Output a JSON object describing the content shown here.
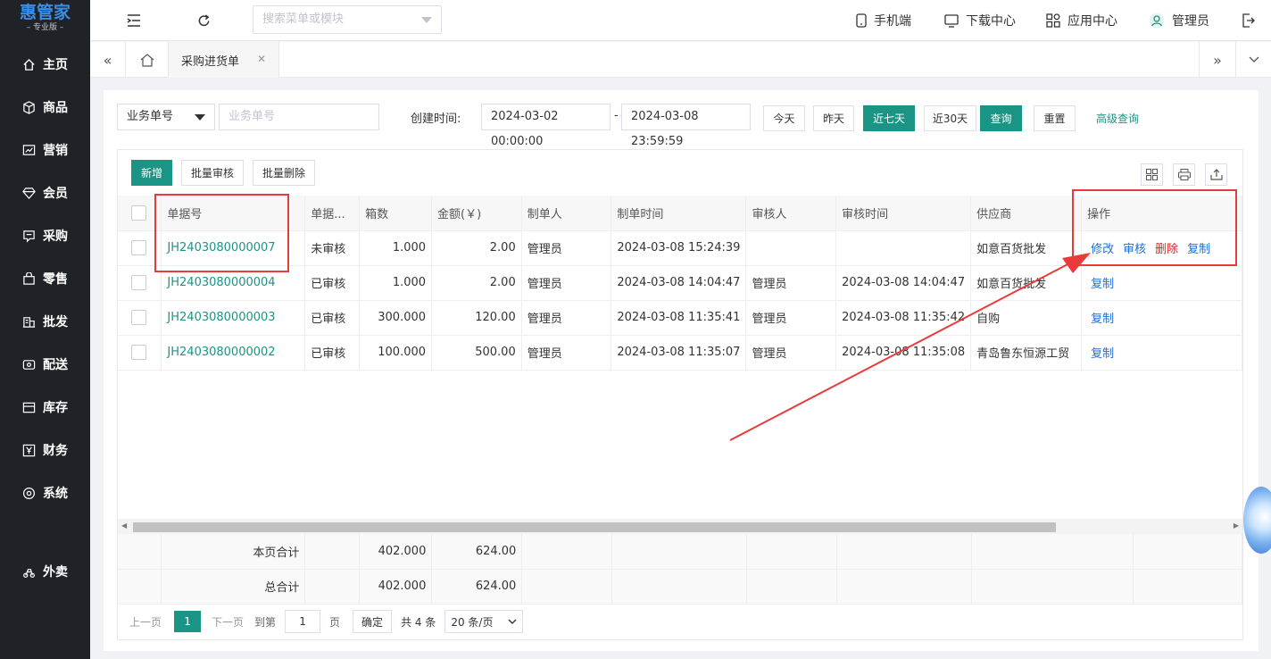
{
  "brand": {
    "name": "惠管家",
    "edition": "– 专业版 –"
  },
  "sidebar": {
    "items": [
      {
        "label": "主页",
        "icon": "home-icon"
      },
      {
        "label": "商品",
        "icon": "cube-icon"
      },
      {
        "label": "营销",
        "icon": "chart-icon"
      },
      {
        "label": "会员",
        "icon": "diamond-icon"
      },
      {
        "label": "采购",
        "icon": "purchase-icon"
      },
      {
        "label": "零售",
        "icon": "bag-icon"
      },
      {
        "label": "批发",
        "icon": "building-icon"
      },
      {
        "label": "配送",
        "icon": "delivery-icon"
      },
      {
        "label": "库存",
        "icon": "inventory-icon"
      },
      {
        "label": "财务",
        "icon": "yen-icon"
      },
      {
        "label": "系统",
        "icon": "settings-icon"
      },
      {
        "label": "外卖",
        "icon": "takeout-icon"
      }
    ]
  },
  "topbar": {
    "search_placeholder": "搜索菜单或模块",
    "mobile": "手机端",
    "download": "下载中心",
    "apps": "应用中心",
    "user": "管理员"
  },
  "tabs": {
    "active": "采购进货单"
  },
  "filter": {
    "field_select": "业务单号",
    "field_placeholder": "业务单号",
    "created_label": "创建时间:",
    "date_from": "2024-03-02 00:00:00",
    "date_sep": "-",
    "date_to": "2024-03-08 23:59:59",
    "btn_today": "今天",
    "btn_yesterday": "昨天",
    "btn_7days": "近七天",
    "btn_30days": "近30天",
    "btn_query": "查询",
    "btn_reset": "重置",
    "btn_advanced": "高级查询"
  },
  "toolbar": {
    "add": "新增",
    "batch_audit": "批量审核",
    "batch_delete": "批量删除"
  },
  "columns": [
    "单据号",
    "单据...",
    "箱数",
    "金额(￥)",
    "制单人",
    "制单时间",
    "审核人",
    "审核时间",
    "供应商",
    "操作"
  ],
  "rows": [
    {
      "code": "JH2403080000007",
      "status": "未审核",
      "boxes": "1.000",
      "amount": "2.00",
      "maker": "管理员",
      "make_time": "2024-03-08 15:24:39",
      "auditor": "",
      "audit_time": "",
      "supplier": "如意百货批发",
      "actions": [
        "修改",
        "审核",
        "删除",
        "复制"
      ]
    },
    {
      "code": "JH2403080000004",
      "status": "已审核",
      "boxes": "1.000",
      "amount": "2.00",
      "maker": "管理员",
      "make_time": "2024-03-08 14:04:47",
      "auditor": "管理员",
      "audit_time": "2024-03-08 14:04:47",
      "supplier": "如意百货批发",
      "actions": [
        "复制"
      ]
    },
    {
      "code": "JH2403080000003",
      "status": "已审核",
      "boxes": "300.000",
      "amount": "120.00",
      "maker": "管理员",
      "make_time": "2024-03-08 11:35:41",
      "auditor": "管理员",
      "audit_time": "2024-03-08 11:35:42",
      "supplier": "自购",
      "actions": [
        "复制"
      ]
    },
    {
      "code": "JH2403080000002",
      "status": "已审核",
      "boxes": "100.000",
      "amount": "500.00",
      "maker": "管理员",
      "make_time": "2024-03-08 11:35:07",
      "auditor": "管理员",
      "audit_time": "2024-03-08 11:35:08",
      "supplier": "青岛鲁东恒源工贸",
      "actions": [
        "复制"
      ]
    }
  ],
  "totals": {
    "page_label": "本页合计",
    "page_boxes": "402.000",
    "page_amount": "624.00",
    "all_label": "总合计",
    "all_boxes": "402.000",
    "all_amount": "624.00"
  },
  "pager": {
    "prev": "上一页",
    "page": "1",
    "next": "下一页",
    "goto": "到第",
    "goto_value": "1",
    "page_unit": "页",
    "confirm": "确定",
    "total": "共 4 条",
    "size": "20 条/页"
  },
  "colors": {
    "accent": "#1a9484",
    "link": "#1e6fd9",
    "danger": "#e02020",
    "annotation": "#e83b3b",
    "sidebar": "#1f2227"
  }
}
